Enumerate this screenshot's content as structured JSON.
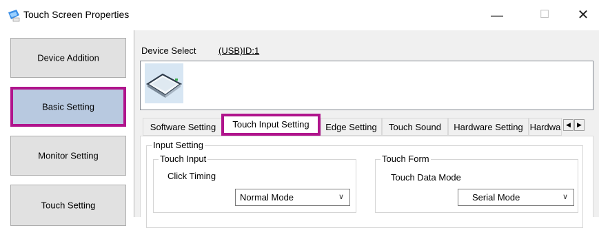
{
  "window": {
    "title": "Touch Screen Properties",
    "buttons": {
      "minimize": "—",
      "maximize": "☐",
      "close": "✕"
    }
  },
  "sidebar": {
    "items": [
      {
        "label": "Device Addition",
        "selected": false
      },
      {
        "label": "Basic Setting",
        "selected": true
      },
      {
        "label": "Monitor Setting",
        "selected": false
      },
      {
        "label": "Touch Setting",
        "selected": false
      }
    ]
  },
  "device": {
    "label": "Device Select",
    "value": "(USB)ID:1",
    "thumbnail_icon": "touch-panel-icon"
  },
  "tabs": {
    "items": [
      {
        "label": "Software Setting",
        "active": false
      },
      {
        "label": "Touch Input Setting",
        "active": true
      },
      {
        "label": "Edge Setting",
        "active": false
      },
      {
        "label": "Touch Sound",
        "active": false
      },
      {
        "label": "Hardware Setting",
        "active": false
      },
      {
        "label": "Hardwa",
        "active": false
      }
    ],
    "scroll_left": "◀",
    "scroll_right": "▶"
  },
  "input_setting": {
    "label": "Input Setting",
    "touch_input": {
      "label": "Touch Input",
      "click_timing_label": "Click Timing",
      "click_timing_value": "Normal Mode"
    },
    "touch_form": {
      "label": "Touch Form",
      "data_mode_label": "Touch Data Mode",
      "data_mode_value": "Serial Mode"
    }
  },
  "colors": {
    "highlight_border": "#b0148c",
    "selected_button_bg": "#b8c9e0"
  }
}
